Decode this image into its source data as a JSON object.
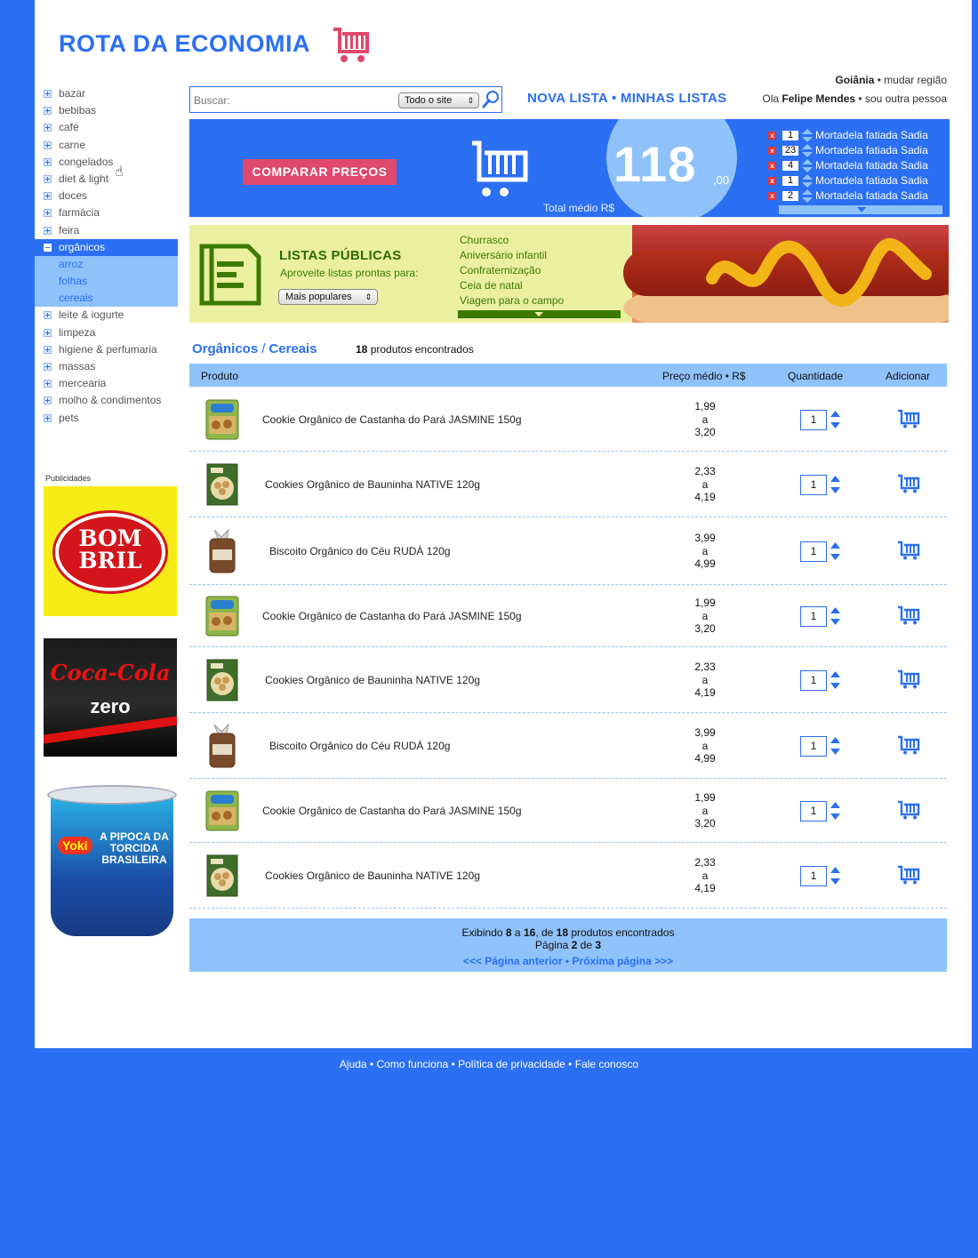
{
  "header": {
    "logo": "ROTA DA ECONOMIA",
    "region_city": "Goiânia",
    "region_sep": " • ",
    "region_change": "mudar região",
    "greeting_prefix": "Ola ",
    "user_name": "Felipe Mendes",
    "greeting_sep": " • ",
    "other_person": "sou outra pessoa"
  },
  "search": {
    "placeholder": "Buscar:",
    "scope": "Todo o site"
  },
  "top_links": {
    "new_list": "NOVA LISTA",
    "sep": " • ",
    "my_lists": "MINHAS LISTAS"
  },
  "sidebar": {
    "categories": [
      "bazar",
      "bebibas",
      "café",
      "carne",
      "congelados",
      "diet & light",
      "doces",
      "farmácia",
      "feira"
    ],
    "active": "orgânicos",
    "subcategories": [
      "arroz",
      "folhas",
      "cereais"
    ],
    "categories_after": [
      "leite & iogurte",
      "limpeza",
      "higiene & perfumaria",
      "massas",
      "mercearia",
      "molho & condimentos",
      "pets"
    ],
    "ads_label": "Publicidades",
    "ads": {
      "bombril": "BOM BRIL",
      "coke_brand": "Coca-Cola",
      "coke_product": "zero",
      "yoki_brand": "Yoki",
      "yoki_slogan": "A PIPOCA DA TORCIDA BRASILEIRA"
    }
  },
  "cart_banner": {
    "compare_button": "COMPARAR PREÇOS",
    "total_value": "118",
    "total_decimal": ",00",
    "total_label": "Total médio R$",
    "items": [
      {
        "qty": "1",
        "name": "Mortadela fatiada Sadia"
      },
      {
        "qty": "23",
        "name": "Mortadela fatiada Sadia"
      },
      {
        "qty": "4",
        "name": "Mortadela fatiada Sadia"
      },
      {
        "qty": "1",
        "name": "Mortadela fatiada Sadia"
      },
      {
        "qty": "2",
        "name": "Mortadela fatiada Sadia"
      }
    ],
    "remove_symbol": "x"
  },
  "public_lists": {
    "title": "LISTAS PÚBLICAS",
    "subtitle": "Aproveite listas prontas para:",
    "sort": "Mais populares",
    "lists": [
      "Churrasco",
      "Aniversário infantil",
      "Confraternização",
      "Ceia de natal",
      "Viagem para o campo"
    ]
  },
  "breadcrumb": {
    "level1": "Orgânicos",
    "sep": "/",
    "level2": "Cereais",
    "count": "18",
    "count_label": " produtos encontrados"
  },
  "table": {
    "headers": {
      "product": "Produto",
      "price": "Preço médio • R$",
      "quantity": "Quantidade",
      "add": "Adicionar"
    },
    "price_sep": "a",
    "rows": [
      {
        "name": "Cookie Orgânico de Castanha do Pará JASMINE 150g",
        "min": "1,99",
        "max": "3,20",
        "qty": "1",
        "img": "jasmine"
      },
      {
        "name": "Cookies Orgânico de Bauninha NATIVE 120g",
        "min": "2,33",
        "max": "4,19",
        "qty": "1",
        "img": "native"
      },
      {
        "name": "Biscoito Orgânico do Céu RUDÁ 120g",
        "min": "3,99",
        "max": "4,99",
        "qty": "1",
        "img": "ruda"
      },
      {
        "name": "Cookie Orgânico de Castanha do Pará JASMINE 150g",
        "min": "1,99",
        "max": "3,20",
        "qty": "1",
        "img": "jasmine"
      },
      {
        "name": "Cookies Orgânico de Bauninha NATIVE 120g",
        "min": "2,33",
        "max": "4,19",
        "qty": "1",
        "img": "native"
      },
      {
        "name": "Biscoito Orgânico do Céu RUDÁ 120g",
        "min": "3,99",
        "max": "4,99",
        "qty": "1",
        "img": "ruda"
      },
      {
        "name": "Cookie Orgânico de Castanha do Pará JASMINE 150g",
        "min": "1,99",
        "max": "3,20",
        "qty": "1",
        "img": "jasmine"
      },
      {
        "name": "Cookies Orgânico de Bauninha NATIVE 120g",
        "min": "2,33",
        "max": "4,19",
        "qty": "1",
        "img": "native"
      }
    ]
  },
  "pager": {
    "showing": "Exibindo",
    "from": "8",
    "a": "a",
    "to": "16",
    "de": ", de",
    "total": "18",
    "found": "produtos encontrados",
    "page_label": "Página",
    "page": "2",
    "page_de": "de",
    "pages": "3",
    "prev": "<<< Página anterior",
    "sep": " • ",
    "next": "Próxima página >>>"
  },
  "footer": {
    "links": [
      "Ajuda",
      "Como funciona",
      "Política de privacidade",
      "Fale conosco"
    ],
    "sep": " • "
  },
  "colors": {
    "brand_blue": "#2b6ff2",
    "light_blue": "#8fc2fb",
    "accent_pink": "#e0486e",
    "list_green": "#3c7a00",
    "list_bg": "#ebf0a1"
  }
}
